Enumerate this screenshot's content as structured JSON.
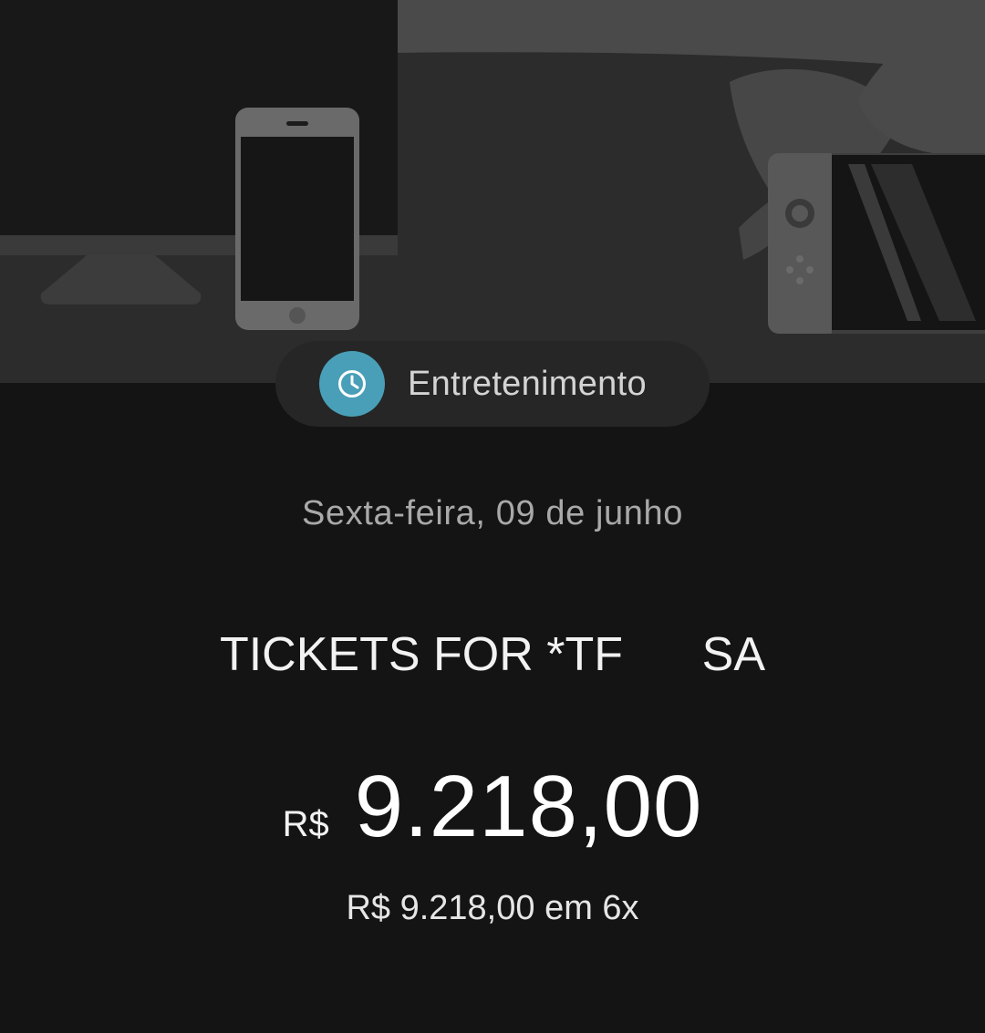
{
  "category": {
    "label": "Entretenimento",
    "icon": "clock-icon",
    "icon_color": "#4a9fb8"
  },
  "transaction": {
    "date": "Sexta-feira, 09 de junho",
    "merchant": "TICKETS FOR *TF      SA",
    "currency": "R$",
    "amount": "9.218,00",
    "installments": "R$ 9.218,00 em 6x"
  },
  "colors": {
    "background": "#141414",
    "hero_background": "#2c2c2c",
    "chip_background": "#262626"
  }
}
